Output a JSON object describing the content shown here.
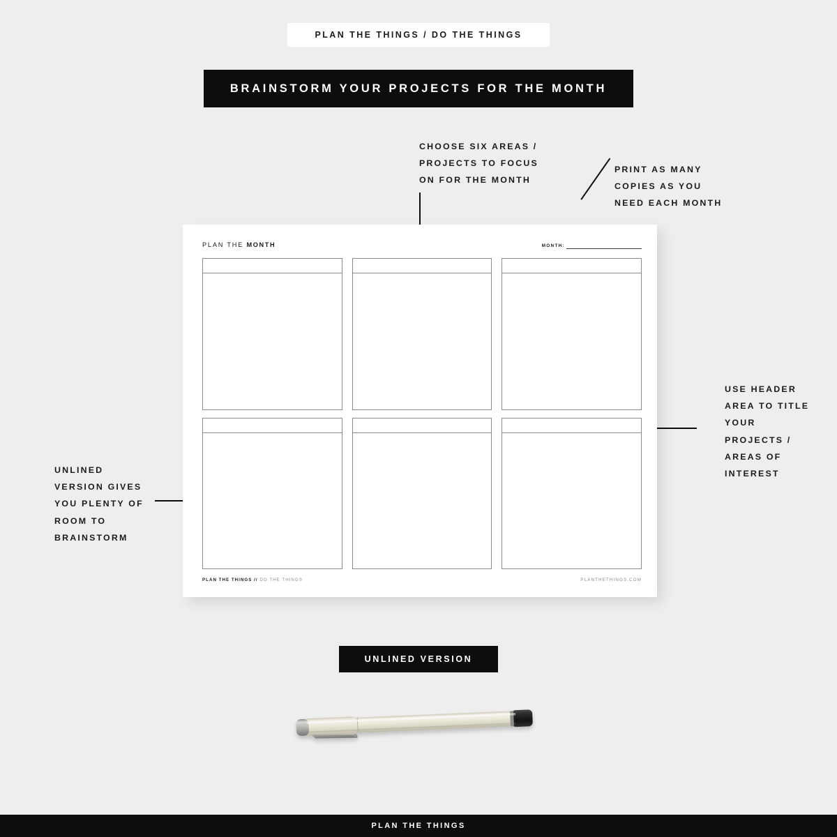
{
  "page": {
    "background_color": "#efeeee",
    "accent_color": "#0d0d0d"
  },
  "eyebrow": {
    "text": "PLAN THE THINGS / DO THE THINGS"
  },
  "title_banner": {
    "text": "BRAINSTORM YOUR PROJECTS FOR THE MONTH"
  },
  "callouts": {
    "center": "CHOOSE SIX AREAS /\nPROJECTS TO FOCUS\nON FOR THE MONTH",
    "top_right": "PRINT AS MANY\nCOPIES AS YOU\nNEED EACH MONTH",
    "right": "USE HEADER\nAREA TO TITLE\nYOUR\nPROJECTS /\nAREAS OF\nINTEREST",
    "left": "UNLINED\nVERSION GIVES\nYOU PLENTY OF\nROOM TO\nBRAINSTORM"
  },
  "planner": {
    "title_prefix": "PLAN THE ",
    "title_strong": "MONTH",
    "month_label": "MONTH:",
    "month_value": "",
    "boxes": [
      {
        "header": "",
        "body": ""
      },
      {
        "header": "",
        "body": ""
      },
      {
        "header": "",
        "body": ""
      },
      {
        "header": "",
        "body": ""
      },
      {
        "header": "",
        "body": ""
      },
      {
        "header": "",
        "body": ""
      }
    ],
    "footer": {
      "brand_bold": "PLAN THE THINGS",
      "separator": " // ",
      "brand_light": "DO THE THINGS",
      "website": "PLANTHETHINGS.COM"
    }
  },
  "version_banner": {
    "text": "UNLINED VERSION"
  },
  "pen": {
    "body_color": "#e3dfce",
    "cap_ring_color": "#9a9a96",
    "tip_color": "#1f1f1f"
  },
  "bottom_bar": {
    "text": "PLAN THE THINGS"
  }
}
